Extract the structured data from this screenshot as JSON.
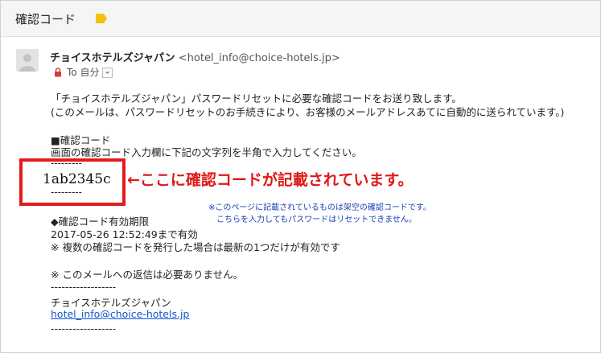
{
  "header": {
    "subject": "確認コード"
  },
  "message": {
    "sender_name": "チョイスホテルズジャパン",
    "sender_email": "<hotel_info@choice-hotels.jp>",
    "to_label": "To 自分",
    "body": {
      "line1": "「チョイスホテルズジャパン」パスワードリセットに必要な確認コードをお送り致します。",
      "line2": "(このメールは、パスワードリセットのお手続きにより、お客様のメールアドレスあてに自動的に送られています。)",
      "section_title": "■確認コード",
      "instruction": "画面の確認コード入力欄に下記の文字列を半角で入力してください。",
      "dashes_short": "---------",
      "code": "1ab2345c",
      "expiry_title": "◆確認コード有効期限",
      "expiry_date": "2017-05-26 12:52:49まで有効",
      "expiry_note": "※ 複数の確認コードを発行した場合は最新の1つだけが有効です",
      "no_reply": "※ このメールへの返信は必要ありません。",
      "dashes_long": "------------------",
      "signature_name": "チョイスホテルズジャパン",
      "signature_email": "hotel_info@choice-hotels.jp"
    }
  },
  "annotation": {
    "arrow_text": "←ここに確認コードが記載されています。",
    "note_line1": "※このページに記載されているものは架空の確認コードです。",
    "note_line2": "こちらを入力してもパスワードはリセットできません。"
  },
  "colors": {
    "annotation_red": "#e01818",
    "note_blue": "#1a3fb8",
    "label_yellow": "#f4c20d"
  }
}
